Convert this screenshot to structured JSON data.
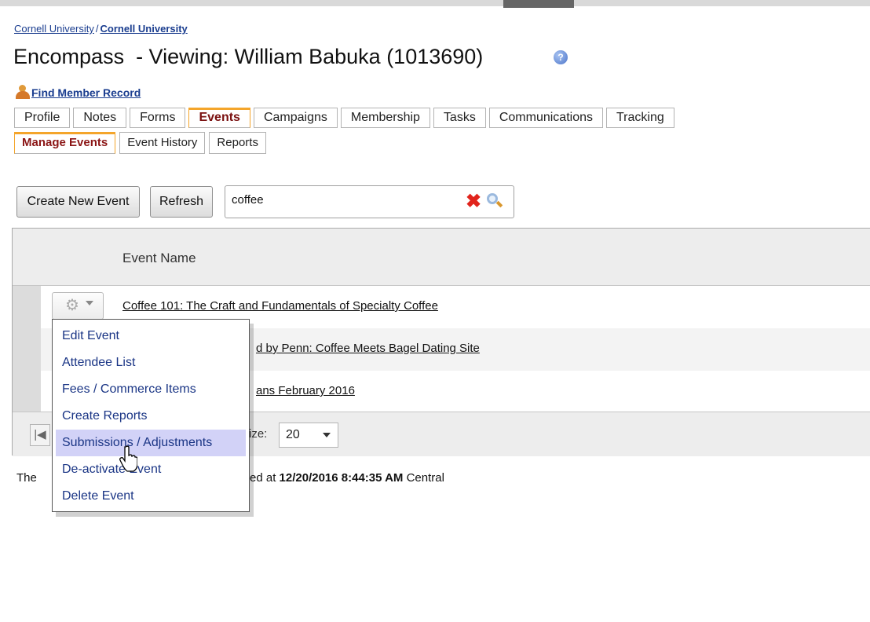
{
  "breadcrumb": {
    "first": "Cornell University",
    "separator": "/",
    "second": "Cornell University"
  },
  "page": {
    "title": "Encompass  - Viewing: William Babuka (1013690)"
  },
  "find_member": {
    "label": "Find Member Record",
    "icon": "member-search-icon"
  },
  "tabs": [
    {
      "label": "Profile"
    },
    {
      "label": "Notes"
    },
    {
      "label": "Forms"
    },
    {
      "label": "Events",
      "active": true
    },
    {
      "label": "Campaigns"
    },
    {
      "label": "Membership"
    },
    {
      "label": "Tasks"
    },
    {
      "label": "Communications"
    },
    {
      "label": "Tracking"
    }
  ],
  "subtabs": [
    {
      "label": "Manage Events",
      "active": true
    },
    {
      "label": "Event History"
    },
    {
      "label": "Reports"
    }
  ],
  "toolbar": {
    "create_label": "Create New Event",
    "refresh_label": "Refresh"
  },
  "search": {
    "value": "coffee",
    "clear_icon": "clear-x-icon",
    "search_icon": "magnifier-icon"
  },
  "grid": {
    "column_header": "Event Name",
    "rows": [
      {
        "name": "Coffee 101: The Craft and Fundamentals of Specialty Coffee"
      },
      {
        "name": "d by Penn: Coffee Meets Bagel Dating Site"
      },
      {
        "name": "ans February 2016"
      }
    ]
  },
  "pager": {
    "first_label": "|◀",
    "pagesize_label": "ize:",
    "pagesize_value": "20"
  },
  "footer": {
    "left": "The",
    "middle": "ed at ",
    "timestamp": "12/20/2016 8:44:35 AM",
    "zone": " Central"
  },
  "action_menu": {
    "items": [
      {
        "label": "Edit Event"
      },
      {
        "label": "Attendee List"
      },
      {
        "label": "Fees / Commerce Items"
      },
      {
        "label": "Create Reports"
      },
      {
        "label": "Submissions / Adjustments",
        "hover": true
      },
      {
        "label": "De-activate Event"
      },
      {
        "label": "Delete Event"
      }
    ]
  },
  "colors": {
    "link": "#1a3d8f",
    "active_tab_border": "#f4a52b",
    "active_tab_text": "#7a1010",
    "menu_hover": "#d2d2f7"
  }
}
